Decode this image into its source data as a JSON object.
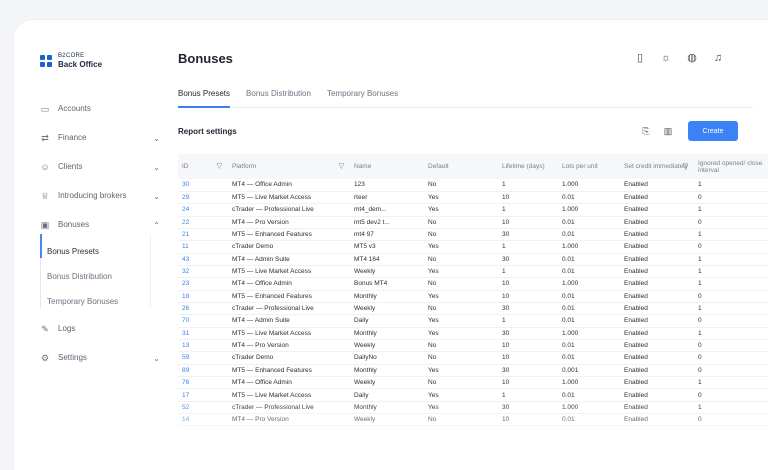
{
  "app": {
    "logo_top": "B2CORE",
    "logo_bottom": "Back Office"
  },
  "sidebar": {
    "items": [
      {
        "label": "Accounts",
        "icon": "wallet-icon"
      },
      {
        "label": "Finance",
        "icon": "transfer-icon"
      },
      {
        "label": "Clients",
        "icon": "users-icon"
      },
      {
        "label": "Introducing brokers",
        "icon": "trophy-icon"
      },
      {
        "label": "Bonuses",
        "icon": "gift-icon"
      },
      {
        "label": "Logs",
        "icon": "logs-icon"
      },
      {
        "label": "Settings",
        "icon": "gear-icon"
      }
    ],
    "bonuses_sub": [
      "Bonus Presets",
      "Bonus Distribution",
      "Temporary Bonuses"
    ]
  },
  "header": {
    "title": "Bonuses",
    "icons": [
      "document-icon",
      "sun-icon",
      "globe-icon",
      "bell-icon"
    ]
  },
  "tabs": [
    "Bonus Presets",
    "Bonus Distribution",
    "Temporary Bonuses"
  ],
  "report": {
    "title": "Report settings",
    "create_label": "Create"
  },
  "table": {
    "columns": [
      "ID",
      "Platform",
      "Name",
      "Default",
      "Lifetime (days)",
      "Lots per unit",
      "Set credit immediately",
      "Ignored opened/ close interval"
    ],
    "rows": [
      [
        "30",
        "MT4 — Office Admin",
        "123",
        "No",
        "1",
        "1.000",
        "Enabled",
        "1"
      ],
      [
        "29",
        "MT5 — Live Market Access",
        "rteer",
        "Yes",
        "10",
        "0.01",
        "Enabled",
        "0"
      ],
      [
        "24",
        "cTrader — Professional Live",
        "mt4_dem...",
        "Yes",
        "1",
        "1.000",
        "Enabled",
        "1"
      ],
      [
        "22",
        "MT4 — Pro Version",
        "mt5 dev2 t...",
        "No",
        "10",
        "0.01",
        "Enabled",
        "0"
      ],
      [
        "21",
        "MT5 — Enhanced Features",
        "mt4 97",
        "No",
        "30",
        "0.01",
        "Enabled",
        "1"
      ],
      [
        "11",
        "cTrader Demo",
        "MT5 v3",
        "Yes",
        "1",
        "1.000",
        "Enabled",
        "0"
      ],
      [
        "43",
        "MT4 — Admin Suite",
        "MT4 164",
        "No",
        "30",
        "0.01",
        "Enabled",
        "1"
      ],
      [
        "32",
        "MT5 — Live Market Access",
        "Weekly",
        "Yes",
        "1",
        "0.01",
        "Enabled",
        "1"
      ],
      [
        "23",
        "MT4 — Office Admin",
        "Bonus MT4",
        "No",
        "10",
        "1.000",
        "Enabled",
        "1"
      ],
      [
        "18",
        "MT5 — Enhanced Features",
        "Monthly",
        "Yes",
        "10",
        "0.01",
        "Enabled",
        "0"
      ],
      [
        "26",
        "cTrader — Professional Live",
        "Weekly",
        "No",
        "30",
        "0.01",
        "Enabled",
        "1"
      ],
      [
        "70",
        "MT4 — Admin Suite",
        "Daily",
        "Yes",
        "1",
        "0.01",
        "Enabled",
        "0"
      ],
      [
        "31",
        "MT5 — Live Market Access",
        "Monthly",
        "Yes",
        "30",
        "1.000",
        "Enabled",
        "1"
      ],
      [
        "13",
        "MT4 — Pro Version",
        "Weekly",
        "No",
        "10",
        "0.01",
        "Enabled",
        "0"
      ],
      [
        "59",
        "cTrader Demo",
        "DailyNo",
        "No",
        "10",
        "0.01",
        "Enabled",
        "0"
      ],
      [
        "89",
        "MT5 — Enhanced Features",
        "Monthly",
        "Yes",
        "30",
        "0.001",
        "Enabled",
        "0"
      ],
      [
        "76",
        "MT4 — Office Admin",
        "Weekly",
        "No",
        "10",
        "1.000",
        "Enabled",
        "1"
      ],
      [
        "17",
        "MT5 — Live Market Access",
        "Daily",
        "Yes",
        "1",
        "0.01",
        "Enabled",
        "0"
      ],
      [
        "52",
        "cTrader — Professional Live",
        "Monthly",
        "Yes",
        "30",
        "1.000",
        "Enabled",
        "1"
      ],
      [
        "14",
        "MT4 — Pro Version",
        "Weekly",
        "No",
        "10",
        "0.01",
        "Enabled",
        "0"
      ]
    ]
  },
  "colors": {
    "accent": "#3b82f6",
    "link": "#3b7ff0"
  }
}
